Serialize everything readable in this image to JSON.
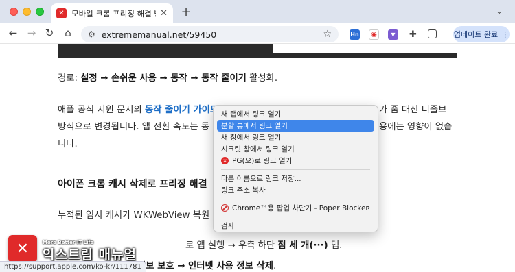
{
  "browser": {
    "tab": {
      "title": "모바일 크롬 프리징 해결 방법 (아이",
      "favicon": "ex-logo"
    },
    "address": {
      "url": "extrememanual.net/59450"
    },
    "update_button": "업데이트 완료",
    "status_url": "https://support.apple.com/ko-kr/111781"
  },
  "article": {
    "path_prefix": "경로: ",
    "path_bold": "설정 → 손쉬운 사용 → 동작 → 동작 줄이기",
    "path_suffix": " 활성화.",
    "p2_line1_a": "애플 공식 지원 문서의 ",
    "p2_link": "동작 줄이기 가이드",
    "p2_line1_b": "가 줌 대신 디졸브",
    "p2_line2_a": "방식으로 변경됩니다. 앱 전환 속도는 동",
    "p2_line2_b": "용에는 영향이 없습",
    "p2_line3": "니다.",
    "heading": "아이폰 크롬 캐시 삭제로 프리징 해결",
    "p3": "누적된 임시 캐시가 WKWebView 복원",
    "p4_a": "로 앱 실행 → 우측 하단 ",
    "p4_b": "점 세 개(···)",
    "p4_c": " 탭.",
    "p5_a": "정보 보호 → 인터넷 사용 정보 삭제",
    "p5_b": "."
  },
  "context_menu": {
    "items": [
      {
        "label": "새 탭에서 링크 열기"
      },
      {
        "label": "분할 뷰에서 링크 열기",
        "highlighted": true
      },
      {
        "label": "새 창에서 링크 열기"
      },
      {
        "label": "시크릿 창에서 링크 열기"
      },
      {
        "label": "PG(으)로 링크 열기",
        "icon": "pg-app-icon"
      },
      {
        "label": "다른 이름으로 링크 저장..."
      },
      {
        "label": "링크 주소 복사"
      },
      {
        "label": "Chrome™용 팝업 차단기 - Poper Blocker",
        "icon": "block-icon",
        "submenu": true
      },
      {
        "label": "검사"
      }
    ]
  },
  "watermark": {
    "tagline": "More Better IT Life",
    "name": "익스트림 매뉴얼"
  }
}
